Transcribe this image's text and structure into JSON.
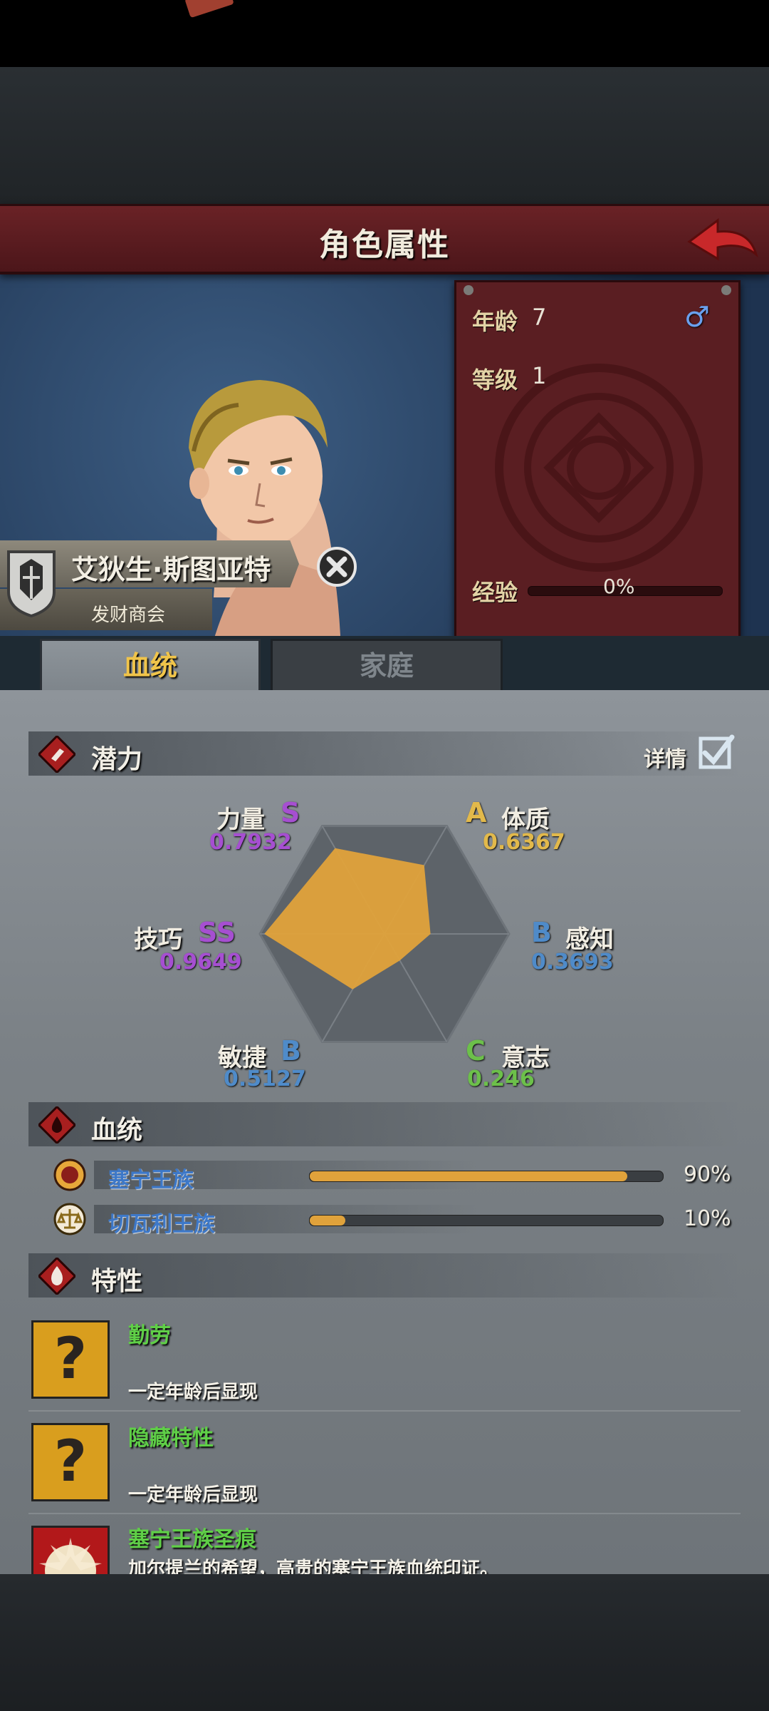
{
  "header": {
    "title": "角色属性"
  },
  "stats": {
    "age_label": "年龄",
    "age": "7",
    "level_label": "等级",
    "level": "1",
    "exp_label": "经验",
    "exp_pct": "0%",
    "exp_fraction": 0
  },
  "character": {
    "name": "艾狄生·斯图亚特",
    "guild": "发财商会"
  },
  "tabs": [
    {
      "label": "血统"
    },
    {
      "label": "家庭"
    }
  ],
  "potential": {
    "title": "潜力",
    "detail_label": "详情",
    "attributes": [
      {
        "name": "力量",
        "grade": "S",
        "score": "0.7932",
        "color": "#a64fd1"
      },
      {
        "name": "体质",
        "grade": "A",
        "score": "0.6367",
        "color": "#e2b94b"
      },
      {
        "name": "感知",
        "grade": "B",
        "score": "0.3693",
        "color": "#4f8bc9"
      },
      {
        "name": "意志",
        "grade": "C",
        "score": "0.246",
        "color": "#6cc04a"
      },
      {
        "name": "敏捷",
        "grade": "B",
        "score": "0.5127",
        "color": "#4f8bc9"
      },
      {
        "name": "技巧",
        "grade": "SS",
        "score": "0.9649",
        "color": "#a64fd1"
      }
    ],
    "fill_color": "#e0a23b"
  },
  "bloodline": {
    "title": "血统",
    "items": [
      {
        "name": "塞宁王族",
        "pct": "90%",
        "fraction": 0.9
      },
      {
        "name": "切瓦利王族",
        "pct": "10%",
        "fraction": 0.1
      }
    ]
  },
  "traits": {
    "title": "特性",
    "items": [
      {
        "name": "勤劳",
        "desc": "一定年龄后显现"
      },
      {
        "name": "隐藏特性",
        "desc": "一定年龄后显现"
      },
      {
        "name": "塞宁王族圣痕",
        "desc": "加尔提兰的希望，高贵的塞宁王族血统印证。"
      }
    ]
  }
}
